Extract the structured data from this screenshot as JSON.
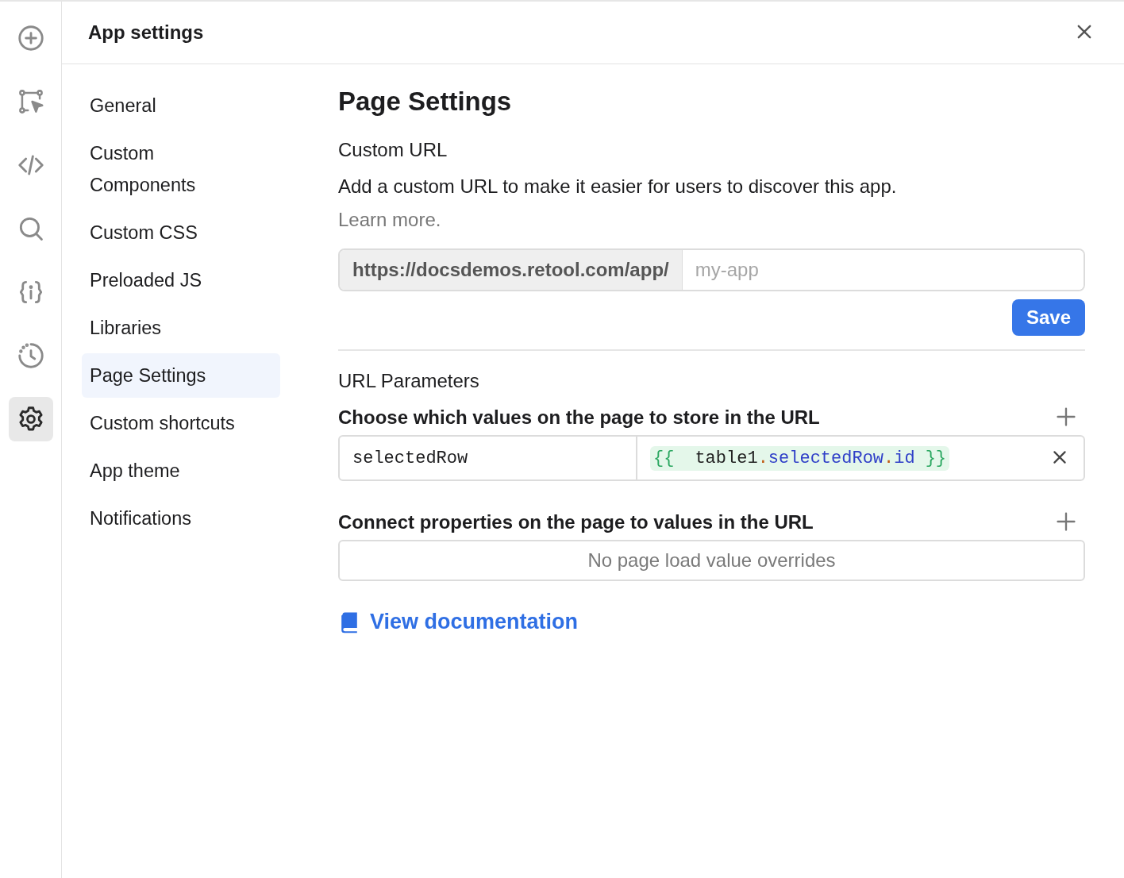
{
  "rail": [
    {
      "kind": "add",
      "selected": false
    },
    {
      "kind": "select",
      "selected": false
    },
    {
      "kind": "code",
      "selected": false
    },
    {
      "kind": "search",
      "selected": false
    },
    {
      "kind": "state",
      "selected": false
    },
    {
      "kind": "history",
      "selected": false
    },
    {
      "kind": "settings",
      "selected": true
    }
  ],
  "header": {
    "title": "App settings"
  },
  "nav": [
    {
      "label": "General",
      "selected": false
    },
    {
      "label": "Custom Components",
      "selected": false
    },
    {
      "label": "Custom CSS",
      "selected": false
    },
    {
      "label": "Preloaded JS",
      "selected": false
    },
    {
      "label": "Libraries",
      "selected": false
    },
    {
      "label": "Page Settings",
      "selected": true
    },
    {
      "label": "Custom shortcuts",
      "selected": false
    },
    {
      "label": "App theme",
      "selected": false
    },
    {
      "label": "Notifications",
      "selected": false
    }
  ],
  "page": {
    "title": "Page Settings",
    "custom_url": {
      "heading": "Custom URL",
      "description": "Add a custom URL to make it easier for users to discover this app.",
      "learn_more": "Learn more.",
      "prefix": "https://docsdemos.retool.com/app/",
      "placeholder": "my-app",
      "save": "Save"
    },
    "url_parameters": {
      "heading": "URL Parameters",
      "store_label": "Choose which values on the page to store in the URL",
      "rows": [
        {
          "key": "selectedRow",
          "expression": [
            {
              "kind": "brace",
              "text": "{{"
            },
            {
              "kind": "plain",
              "text": "table1"
            },
            {
              "kind": "dot",
              "text": "."
            },
            {
              "kind": "prop",
              "text": "selectedRow"
            },
            {
              "kind": "dot",
              "text": "."
            },
            {
              "kind": "prop",
              "text": "id"
            },
            {
              "kind": "brace",
              "text": "}}"
            }
          ]
        }
      ],
      "connect_label": "Connect properties on the page to values in the URL",
      "empty": "No page load value overrides"
    },
    "doc_link": "View documentation"
  }
}
